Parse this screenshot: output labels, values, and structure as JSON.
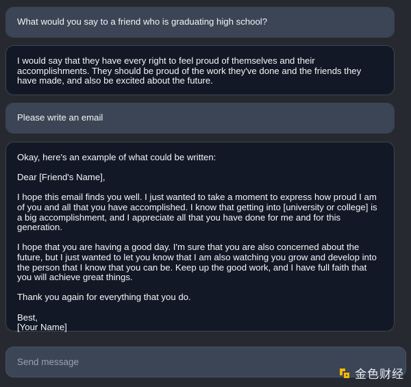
{
  "messages": [
    {
      "role": "user",
      "paragraphs": [
        "What would you say to a friend who is graduating high school?"
      ]
    },
    {
      "role": "assistant",
      "paragraphs": [
        "I would say that they have every right to feel proud of themselves and their accomplishments. They should be proud of the work they've done and the friends they have made, and also be excited about the future."
      ]
    },
    {
      "role": "user",
      "paragraphs": [
        "Please write an email"
      ]
    },
    {
      "role": "assistant",
      "paragraphs": [
        "Okay, here's an example of what could be written:",
        "Dear [Friend's Name],",
        "I hope this email finds you well. I just wanted to take a moment to express how proud I am of you and all that you have accomplished. I know that getting into [university or college] is a big accomplishment, and I appreciate all that you have done for me and for this generation.",
        "I hope that you are having a good day. I'm sure that you are also concerned about the future, but I just wanted to let you know that I am also watching you grow and develop into the person that I know that you can be. Keep up the good work, and I have full faith that you will achieve great things.",
        "Thank you again for everything that you do.",
        "Best,",
        "[Your Name]"
      ]
    }
  ],
  "input": {
    "placeholder": "Send message"
  },
  "watermark": {
    "text": "金色财经",
    "logo_icon": "jinse-logo-icon"
  },
  "colors": {
    "page_bg": "#262a30",
    "user_bubble": "#3b4555",
    "bot_bubble": "#121826",
    "text": "#f3f5f8",
    "accent": "#f5b800"
  }
}
